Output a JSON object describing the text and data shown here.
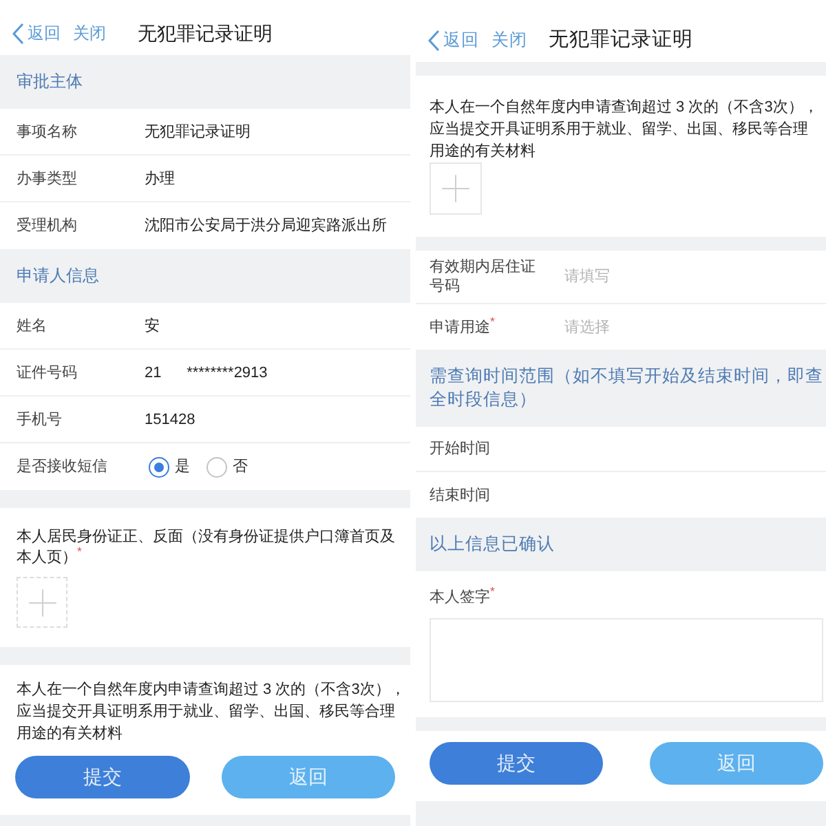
{
  "panels": [
    {
      "nav": {
        "back": "返回",
        "close": "关闭",
        "title": "无犯罪记录证明"
      },
      "blocks": [
        {
          "kind": "header",
          "text": "审批主体"
        },
        {
          "kind": "rows",
          "rows": [
            {
              "kind": "text",
              "label": "事项名称",
              "value": "无犯罪记录证明"
            },
            {
              "kind": "text",
              "label": "办事类型",
              "value": "办理"
            },
            {
              "kind": "text",
              "label": "受理机构",
              "value": "沈阳市公安局于洪分局迎宾路派出所"
            }
          ]
        },
        {
          "kind": "header",
          "text": "申请人信息"
        },
        {
          "kind": "rows",
          "rows": [
            {
              "kind": "text",
              "label": "姓名",
              "value": "安"
            },
            {
              "kind": "text",
              "label": "证件号码",
              "value": "21      ********2913"
            },
            {
              "kind": "text",
              "label": "手机号",
              "value": "151428"
            },
            {
              "kind": "radio",
              "label": "是否接收短信",
              "options": [
                {
                  "label": "是",
                  "selected": true
                },
                {
                  "label": "否",
                  "selected": false
                }
              ]
            }
          ]
        },
        {
          "kind": "upload",
          "text": "本人居民身份证正、反面（没有身份证提供户口簿首页及本人页）$^{*}$"
        },
        {
          "kind": "note",
          "text": "本人在一个自然年度内申请查询超过 3 次的（不含3次），应当提交开具证明系用于就业、留学、出国、移民等合理用途的有关材料"
        }
      ],
      "buttons": [
        {
          "kind": "primary",
          "label": "提交"
        },
        {
          "kind": "secondary",
          "label": "返回"
        }
      ]
    },
    {
      "nav": {
        "back": "返回",
        "close": "关闭",
        "title": "无犯罪记录证明"
      },
      "blocks": [
        {
          "kind": "upload",
          "text": "本人在一个自然年度内申请查询超过 3 次的（不含3次），应当提交开具证明系用于就业、留学、出国、移民等合理用途的有关材料"
        },
        {
          "kind": "rows",
          "rows": [
            {
              "kind": "input",
              "label": "有效期内居住证号码",
              "placeholder": "请填写"
            },
            {
              "kind": "select",
              "label": "申请用途$^{*}$",
              "placeholder": "请选择"
            }
          ]
        },
        {
          "kind": "header",
          "text": "需查询时间范围（如不填写开始及结束时间，即查全时段信息）"
        },
        {
          "kind": "rows",
          "rows": [
            {
              "kind": "plain",
              "label": "开始时间"
            },
            {
              "kind": "plain",
              "label": "结束时间"
            }
          ]
        },
        {
          "kind": "header",
          "text": "以上信息已确认"
        },
        {
          "kind": "signature",
          "label": "本人签字$^{*}$"
        }
      ],
      "buttons": [
        {
          "kind": "primary",
          "label": "提交"
        },
        {
          "kind": "secondary",
          "label": "返回"
        }
      ]
    }
  ]
}
